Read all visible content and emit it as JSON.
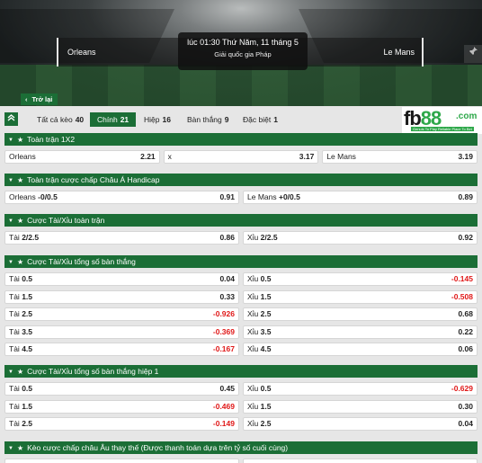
{
  "match": {
    "datetime": "lúc 01:30 Thứ Năm, 11 tháng 5",
    "league": "Giải quốc gia Pháp",
    "home": "Orleans",
    "away": "Le Mans",
    "back_label": "Trở lại"
  },
  "tabs": [
    {
      "label": "Tất cả kèo",
      "count": "40"
    },
    {
      "label": "Chính",
      "count": "21"
    },
    {
      "label": "Hiệp",
      "count": "16"
    },
    {
      "label": "Bàn thắng",
      "count": "9"
    },
    {
      "label": "Đặc biệt",
      "count": "1"
    }
  ],
  "logo": {
    "text_a": "fb",
    "text_b": "88",
    "suffix": ".com",
    "tagline": "Genuis To Play  Reliable Place To Bet"
  },
  "sections": [
    {
      "title": "Toàn trận 1X2",
      "rows": [
        {
          "cells": [
            {
              "label": "Orleans",
              "line": "",
              "odd": "2.21"
            },
            {
              "label": "x",
              "line": "",
              "odd": "3.17"
            },
            {
              "label": "Le Mans",
              "line": "",
              "odd": "3.19"
            }
          ]
        }
      ]
    },
    {
      "title": "Toàn trận cược chấp Châu Á Handicap",
      "rows": [
        {
          "cells": [
            {
              "label": "Orleans",
              "line": "-0/0.5",
              "odd": "0.91"
            },
            {
              "label": "Le Mans",
              "line": "+0/0.5",
              "odd": "0.89"
            }
          ]
        }
      ]
    },
    {
      "title": "Cược Tài/Xỉu toàn trận",
      "rows": [
        {
          "cells": [
            {
              "label": "Tài",
              "line": "2/2.5",
              "odd": "0.86"
            },
            {
              "label": "Xỉu",
              "line": "2/2.5",
              "odd": "0.92"
            }
          ]
        }
      ]
    },
    {
      "title": "Cược Tài/Xỉu tổng số bàn thắng",
      "rows": [
        {
          "cells": [
            {
              "label": "Tài",
              "line": "0.5",
              "odd": "0.04"
            },
            {
              "label": "Xỉu",
              "line": "0.5",
              "odd": "-0.145"
            }
          ]
        },
        {
          "cells": [
            {
              "label": "Tài",
              "line": "1.5",
              "odd": "0.33"
            },
            {
              "label": "Xỉu",
              "line": "1.5",
              "odd": "-0.508"
            }
          ]
        },
        {
          "cells": [
            {
              "label": "Tài",
              "line": "2.5",
              "odd": "-0.926"
            },
            {
              "label": "Xỉu",
              "line": "2.5",
              "odd": "0.68"
            }
          ]
        },
        {
          "cells": [
            {
              "label": "Tài",
              "line": "3.5",
              "odd": "-0.369"
            },
            {
              "label": "Xỉu",
              "line": "3.5",
              "odd": "0.22"
            }
          ]
        },
        {
          "cells": [
            {
              "label": "Tài",
              "line": "4.5",
              "odd": "-0.167"
            },
            {
              "label": "Xỉu",
              "line": "4.5",
              "odd": "0.06"
            }
          ]
        }
      ]
    },
    {
      "title": "Cược Tài/Xỉu tổng số bàn thắng hiệp 1",
      "rows": [
        {
          "cells": [
            {
              "label": "Tài",
              "line": "0.5",
              "odd": "0.45"
            },
            {
              "label": "Xỉu",
              "line": "0.5",
              "odd": "-0.629"
            }
          ]
        },
        {
          "cells": [
            {
              "label": "Tài",
              "line": "1.5",
              "odd": "-0.469"
            },
            {
              "label": "Xỉu",
              "line": "1.5",
              "odd": "0.30"
            }
          ]
        },
        {
          "cells": [
            {
              "label": "Tài",
              "line": "2.5",
              "odd": "-0.149"
            },
            {
              "label": "Xỉu",
              "line": "2.5",
              "odd": "0.04"
            }
          ]
        }
      ]
    },
    {
      "title": "Kèo cược chấp châu Âu thay thế (Được thanh toán dựa trên tỷ số cuối cùng)",
      "rows": []
    }
  ],
  "colors": {
    "accent": "#1b6e36",
    "negative": "#e01818",
    "background": "#e6e6e6"
  },
  "icons": {
    "collapse": "chevrons-up-icon",
    "section": "caret-down-icon",
    "favorite": "star-icon",
    "back": "chevron-left-icon",
    "pin": "pin-icon"
  }
}
